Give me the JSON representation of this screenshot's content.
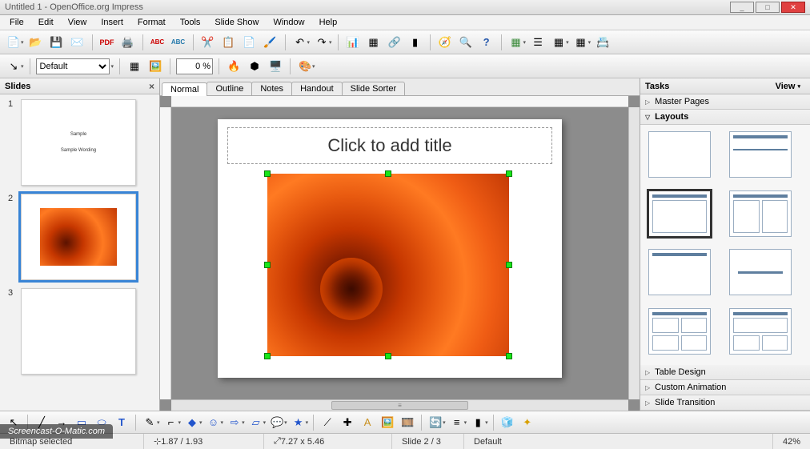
{
  "window": {
    "title": "Untitled 1 - OpenOffice.org Impress"
  },
  "menu": {
    "items": [
      "File",
      "Edit",
      "View",
      "Insert",
      "Format",
      "Tools",
      "Slide Show",
      "Window",
      "Help"
    ]
  },
  "toolbar2": {
    "style_value": "Default",
    "zoom_value": "0 %"
  },
  "panes": {
    "slides_title": "Slides",
    "tasks_title": "Tasks",
    "tasks_view": "View",
    "sections": {
      "master": "Master Pages",
      "layouts": "Layouts",
      "table": "Table Design",
      "anim": "Custom Animation",
      "trans": "Slide Transition"
    }
  },
  "tabs": {
    "items": [
      "Normal",
      "Outline",
      "Notes",
      "Handout",
      "Slide Sorter"
    ],
    "active": 0
  },
  "slides": [
    {
      "num": "1",
      "title": "Sample",
      "sub": "Sample Wording"
    },
    {
      "num": "2",
      "title": "",
      "sub": "",
      "image": true,
      "selected": true
    },
    {
      "num": "3",
      "title": "",
      "sub": ""
    }
  ],
  "slide_editor": {
    "title_placeholder": "Click to add title"
  },
  "status": {
    "selected": "Bitmap selected",
    "pos": "1.87 / 1.93",
    "size": "7.27 x 5.46",
    "slide": "Slide 2 / 3",
    "layout": "Default",
    "zoom": "42%"
  },
  "watermark": "Screencast-O-Matic.com"
}
